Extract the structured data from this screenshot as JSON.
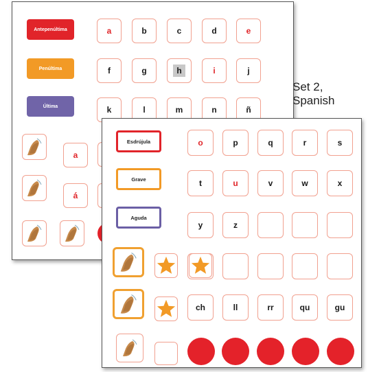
{
  "caption": {
    "line1": "Set 2,",
    "line2": "Spanish"
  },
  "sheet1": {
    "labels": {
      "antepenultima": "Antepenúltima",
      "penultima": "Penúltima",
      "ultima": "Última"
    },
    "colors": {
      "red": "#e1242a",
      "orange": "#f29a26",
      "purple": "#7064a8"
    },
    "rows": [
      [
        {
          "t": "a",
          "c": "red"
        },
        {
          "t": "b",
          "c": "black"
        },
        {
          "t": "c",
          "c": "black"
        },
        {
          "t": "d",
          "c": "black"
        },
        {
          "t": "e",
          "c": "red"
        }
      ],
      [
        {
          "t": "f",
          "c": "black"
        },
        {
          "t": "g",
          "c": "black"
        },
        {
          "t": "h",
          "c": "black"
        },
        {
          "t": "i",
          "c": "red"
        },
        {
          "t": "j",
          "c": "black"
        }
      ],
      [
        {
          "t": "k",
          "c": "black"
        },
        {
          "t": "l",
          "c": "black"
        },
        {
          "t": "m",
          "c": "black"
        },
        {
          "t": "n",
          "c": "black"
        },
        {
          "t": "ñ",
          "c": "black"
        }
      ]
    ],
    "lower_left_letters": [
      "a",
      "á"
    ]
  },
  "sheet2": {
    "labels": {
      "esdrujula": "Esdrújula",
      "grave": "Grave",
      "aguda": "Aguda"
    },
    "colors": {
      "red": "#e1242a",
      "orange": "#f29a26",
      "purple": "#6b5fa5"
    },
    "rows": [
      [
        {
          "t": "o",
          "c": "red"
        },
        {
          "t": "p",
          "c": "black"
        },
        {
          "t": "q",
          "c": "black"
        },
        {
          "t": "r",
          "c": "black"
        },
        {
          "t": "s",
          "c": "black"
        }
      ],
      [
        {
          "t": "t",
          "c": "black"
        },
        {
          "t": "u",
          "c": "red"
        },
        {
          "t": "v",
          "c": "black"
        },
        {
          "t": "w",
          "c": "black"
        },
        {
          "t": "x",
          "c": "black"
        }
      ],
      [
        {
          "t": "y",
          "c": "black"
        },
        {
          "t": "z",
          "c": "black"
        },
        {
          "t": "",
          "c": "black"
        },
        {
          "t": "",
          "c": "black"
        },
        {
          "t": "",
          "c": "black"
        }
      ],
      [
        {
          "t": "",
          "c": "black"
        },
        {
          "t": "",
          "c": "black"
        },
        {
          "t": "",
          "c": "black"
        },
        {
          "t": "",
          "c": "black"
        },
        {
          "t": "",
          "c": "black"
        }
      ],
      [
        {
          "t": "ch",
          "c": "black"
        },
        {
          "t": "ll",
          "c": "black"
        },
        {
          "t": "rr",
          "c": "black"
        },
        {
          "t": "qu",
          "c": "black"
        },
        {
          "t": "gu",
          "c": "black"
        }
      ]
    ]
  },
  "icons": {
    "clap": "clapping-hands-icon",
    "star": "star-icon",
    "dot": "red-dot"
  }
}
